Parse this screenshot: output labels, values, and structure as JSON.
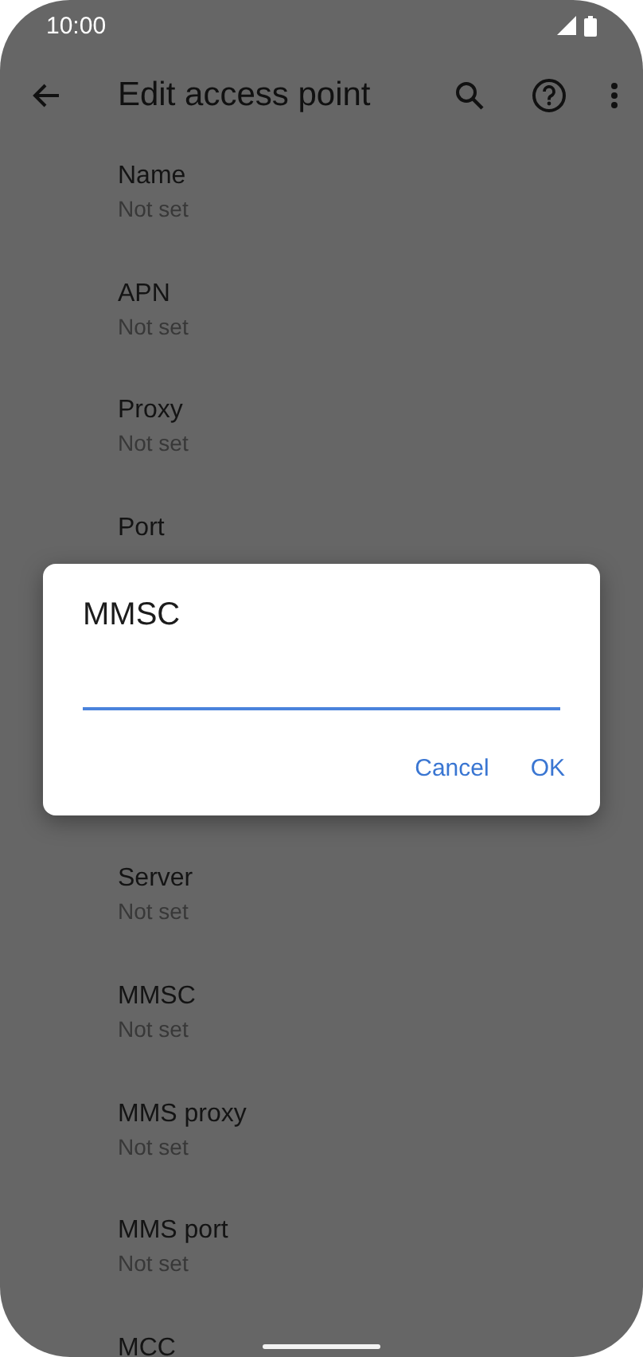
{
  "status_bar": {
    "time": "10:00"
  },
  "toolbar": {
    "title": "Edit access point"
  },
  "settings": {
    "above_dialog": [
      {
        "title": "Name",
        "value": "Not set"
      },
      {
        "title": "APN",
        "value": "Not set"
      },
      {
        "title": "Proxy",
        "value": "Not set"
      },
      {
        "title": "Port"
      }
    ],
    "below_dialog": [
      {
        "title": "Server",
        "value": "Not set"
      },
      {
        "title": "MMSC",
        "value": "Not set"
      },
      {
        "title": "MMS proxy",
        "value": "Not set"
      },
      {
        "title": "MMS port",
        "value": "Not set"
      },
      {
        "title": "MCC"
      }
    ]
  },
  "dialog": {
    "title": "MMSC",
    "buttons": [
      "Cancel",
      "OK"
    ]
  }
}
